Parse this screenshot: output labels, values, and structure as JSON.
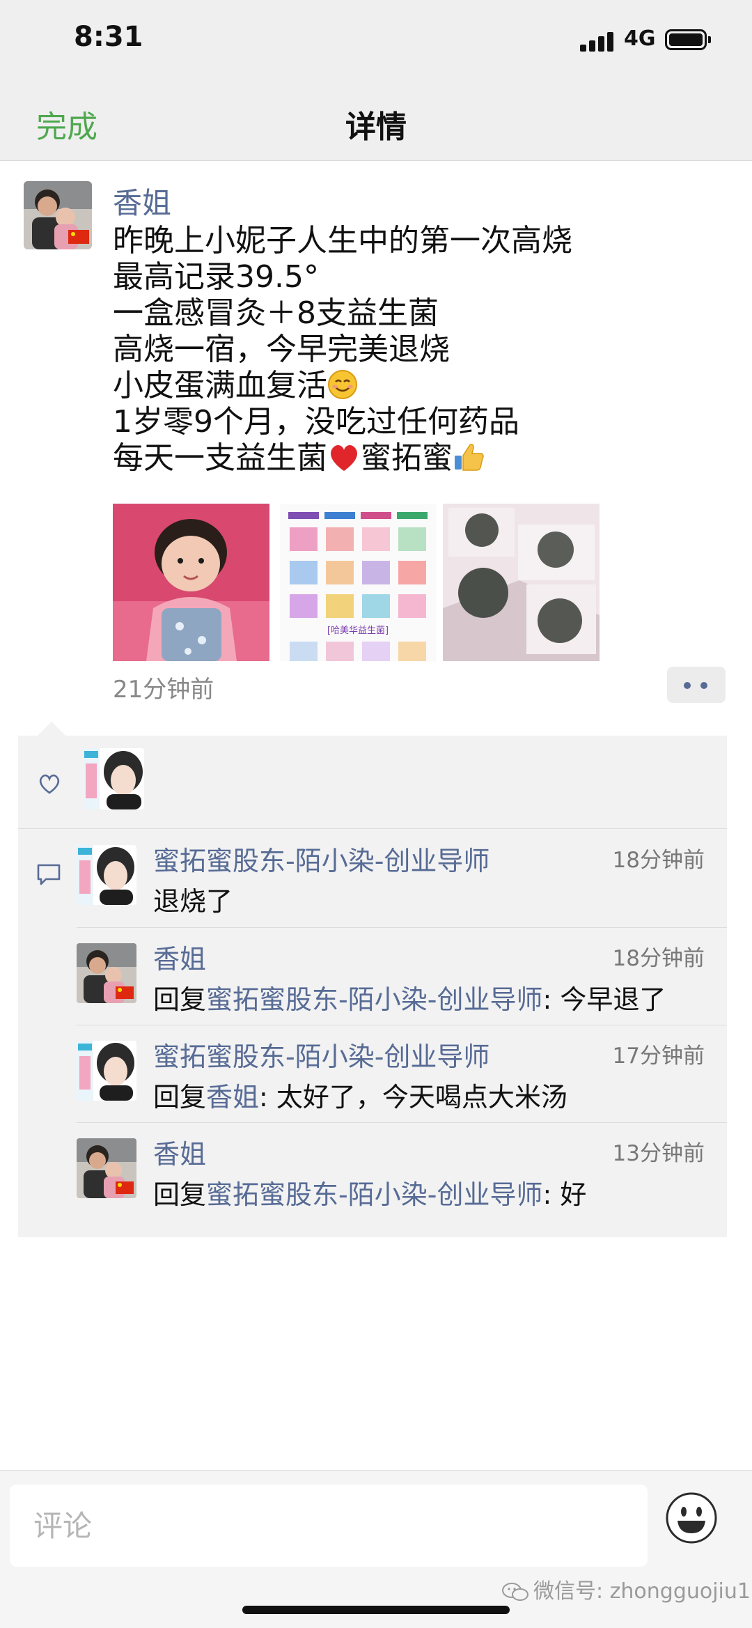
{
  "status_bar": {
    "time": "8:31",
    "network": "4G"
  },
  "nav": {
    "done_label": "完成",
    "title": "详情"
  },
  "post": {
    "author": "香姐",
    "lines": [
      "昨晚上小妮子人生中的第一次高烧",
      "最高记录39.5°",
      "一盒感冒灸＋8支益生菌",
      "高烧一宿，今早完美退烧",
      "小皮蛋满血复活",
      "1岁零9个月，没吃过任何药品",
      "每天一支益生菌",
      "蜜拓蜜"
    ],
    "photo_banner": "[哈美华益生菌]",
    "time": "21分钟前"
  },
  "comments": [
    {
      "name": "蜜拓蜜股东-陌小染-创业导师",
      "time": "18分钟前",
      "text": "退烧了"
    },
    {
      "name": "香姐",
      "time": "18分钟前",
      "reply_prefix": "回复",
      "reply_to": "蜜拓蜜股东-陌小染-创业导师",
      "text": ": 今早退了"
    },
    {
      "name": "蜜拓蜜股东-陌小染-创业导师",
      "time": "17分钟前",
      "reply_prefix": "回复",
      "reply_to": "香姐",
      "text": ": 太好了，今天喝点大米汤"
    },
    {
      "name": "香姐",
      "time": "13分钟前",
      "reply_prefix": "回复",
      "reply_to": "蜜拓蜜股东-陌小染-创业导师",
      "text": ": 好"
    }
  ],
  "bottom": {
    "comment_placeholder": "评论",
    "watermark": "微信号: zhongguojiu1"
  },
  "colors": {
    "link": "#576b95",
    "done_green": "#4fa84f",
    "panel_bg": "#f2f2f2"
  },
  "icons": [
    "signal-icon",
    "battery-icon",
    "heart-icon",
    "comment-icon",
    "more-dots-icon",
    "emoji-icon",
    "smile-emoji",
    "red-heart-emoji",
    "thumbs-up-emoji",
    "wechat-icon"
  ]
}
